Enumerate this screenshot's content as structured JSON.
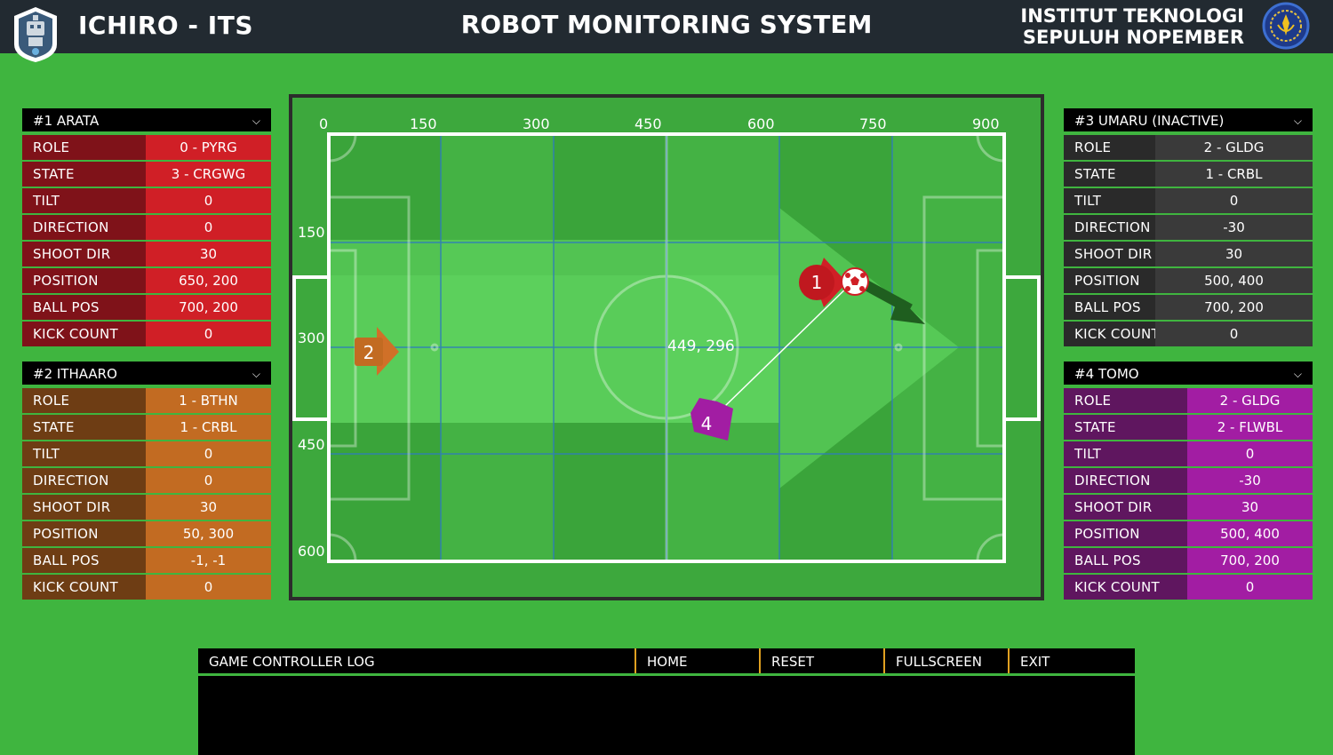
{
  "header": {
    "team": "ICHIRO - ITS",
    "title": "ROBOT MONITORING SYSTEM",
    "institute_line1": "INSTITUT TEKNOLOGI",
    "institute_line2": "SEPULUH NOPEMBER"
  },
  "colors": {
    "background": "#3fb53f",
    "robot1": "#d01f26",
    "robot2": "#c26b22",
    "robot3": "#3a3a3a",
    "robot4": "#a21da3"
  },
  "robots": [
    {
      "title": "#1 ARATA",
      "rows": [
        {
          "label": "ROLE",
          "value": "0 - PYRG"
        },
        {
          "label": "STATE",
          "value": "3 - CRGWG"
        },
        {
          "label": "TILT",
          "value": "0"
        },
        {
          "label": "DIRECTION",
          "value": "0"
        },
        {
          "label": "SHOOT DIR",
          "value": "30"
        },
        {
          "label": "POSITION",
          "value": "650, 200"
        },
        {
          "label": "BALL POS",
          "value": "700, 200"
        },
        {
          "label": "KICK COUNT",
          "value": "0"
        }
      ]
    },
    {
      "title": "#2 ITHAARO",
      "rows": [
        {
          "label": "ROLE",
          "value": "1 - BTHN"
        },
        {
          "label": "STATE",
          "value": "1 - CRBL"
        },
        {
          "label": "TILT",
          "value": "0"
        },
        {
          "label": "DIRECTION",
          "value": "0"
        },
        {
          "label": "SHOOT DIR",
          "value": "30"
        },
        {
          "label": "POSITION",
          "value": "50, 300"
        },
        {
          "label": "BALL POS",
          "value": "-1, -1"
        },
        {
          "label": "KICK COUNT",
          "value": "0"
        }
      ]
    },
    {
      "title": "#3 UMARU (INACTIVE)",
      "rows": [
        {
          "label": "ROLE",
          "value": "2 - GLDG"
        },
        {
          "label": "STATE",
          "value": "1 - CRBL"
        },
        {
          "label": "TILT",
          "value": "0"
        },
        {
          "label": "DIRECTION",
          "value": "-30"
        },
        {
          "label": "SHOOT DIR",
          "value": "30"
        },
        {
          "label": "POSITION",
          "value": "500, 400"
        },
        {
          "label": "BALL POS",
          "value": "700, 200"
        },
        {
          "label": "KICK COUNT",
          "value": "0"
        }
      ]
    },
    {
      "title": "#4 TOMO",
      "rows": [
        {
          "label": "ROLE",
          "value": "2 - GLDG"
        },
        {
          "label": "STATE",
          "value": "2 - FLWBL"
        },
        {
          "label": "TILT",
          "value": "0"
        },
        {
          "label": "DIRECTION",
          "value": "-30"
        },
        {
          "label": "SHOOT DIR",
          "value": "30"
        },
        {
          "label": "POSITION",
          "value": "500, 400"
        },
        {
          "label": "BALL POS",
          "value": "700, 200"
        },
        {
          "label": "KICK COUNT",
          "value": "0"
        }
      ]
    }
  ],
  "field": {
    "x_ticks": [
      "0",
      "150",
      "300",
      "450",
      "600",
      "750",
      "900"
    ],
    "y_ticks": [
      "150",
      "300",
      "450",
      "600"
    ],
    "cursor_readout": "449, 296",
    "markers": {
      "r1": "1",
      "r2": "2",
      "r4": "4"
    }
  },
  "bottom": {
    "log_title": "GAME CONTROLLER LOG",
    "home": "HOME",
    "reset": "RESET",
    "fullscreen": "FULLSCREEN",
    "exit": "EXIT"
  },
  "icons": {
    "dropdown": "chevron-down-icon",
    "team_logo": "robot-shield-logo",
    "institute_logo": "its-logo"
  }
}
